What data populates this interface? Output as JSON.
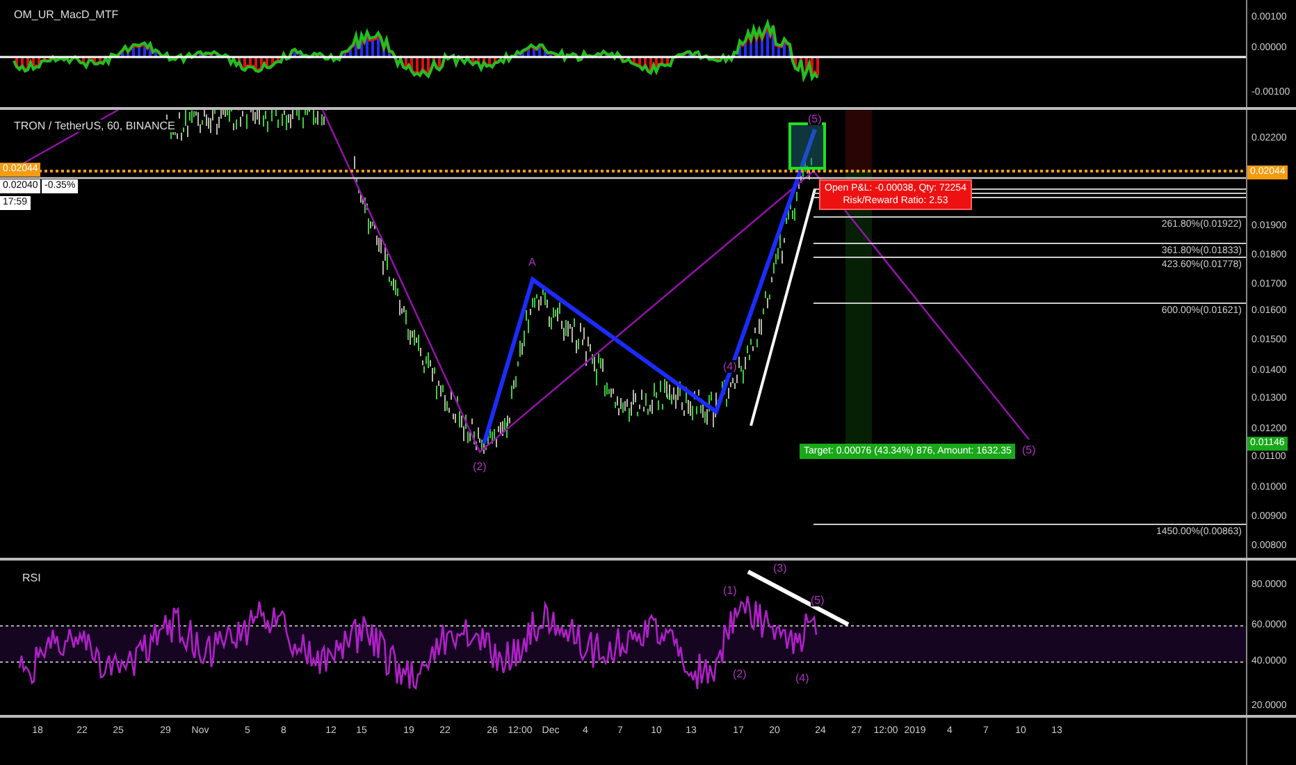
{
  "indicator_pane": {
    "title": "OM_UR_MacD_MTF",
    "axis_ticks": [
      "0.00100",
      "0.00000",
      "-0.00100"
    ]
  },
  "main_pane": {
    "title": "TRON / TetherUS, 60, BINANCE",
    "axis_ticks": [
      "0.02200",
      "0.01900",
      "0.01800",
      "0.01700",
      "0.01600",
      "0.01500",
      "0.01400",
      "0.01300",
      "0.01200",
      "0.01100",
      "0.01000",
      "0.00900",
      "0.00800"
    ],
    "price_badges": [
      {
        "text": "0.02044",
        "kind": "current"
      },
      {
        "text": "0.01146",
        "kind": "target"
      }
    ],
    "left_badges": [
      {
        "text": "0.02044",
        "kind": "current"
      },
      {
        "text": "0.02040",
        "kind": "plain"
      },
      {
        "text": "-0.35%",
        "kind": "plain"
      },
      {
        "text": "17:59",
        "kind": "plain"
      }
    ],
    "position": {
      "pnl": "Open P&L: -0.00038, Qty: 72254",
      "ratio": "Risk/Reward Ratio: 2.53",
      "target": "Target: 0.00076 (43.34%) 876, Amount: 1632.35"
    },
    "fib_levels": [
      "261.80%(0.01922)",
      "361.80%(0.01833)",
      "423.60%(0.01778)",
      "600.00%(0.01621)",
      "1450.00%(0.00863)"
    ],
    "wave_labels": [
      "(2)",
      "A",
      "(4)",
      "(5)",
      "(5)"
    ]
  },
  "rsi_pane": {
    "title": "RSI",
    "axis_ticks": [
      "80.0000",
      "60.0000",
      "40.0000",
      "20.0000"
    ],
    "wave_labels": [
      "(1)",
      "(3)",
      "(5)",
      "(2)",
      "(4)"
    ]
  },
  "time_axis": {
    "ticks": [
      "18",
      "22",
      "25",
      "29",
      "Nov",
      "5",
      "8",
      "12",
      "15",
      "19",
      "22",
      "26",
      "12:00",
      "Dec",
      "4",
      "7",
      "10",
      "13",
      "17",
      "20",
      "24",
      "27",
      "12:00",
      "2019",
      "4",
      "7",
      "10",
      "13"
    ]
  }
}
